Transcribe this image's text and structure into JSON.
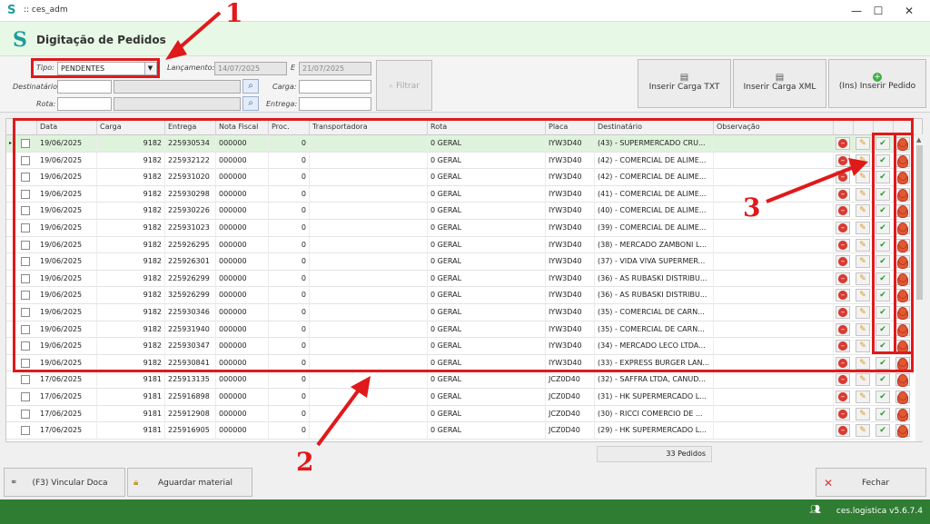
{
  "window": {
    "title": ":: ces_adm",
    "minimize": "—",
    "maximize": "☐",
    "close": "✕"
  },
  "header": {
    "title": "Digitação de Pedidos"
  },
  "filter": {
    "tipo_label": "Tipo:",
    "tipo_value": "PENDENTES",
    "lancamento_label": "Lançamento:",
    "lancamento_from": "14/07/2025",
    "e_label": "E",
    "lancamento_to": "21/07/2025",
    "destinatario_label": "Destinatário:",
    "rota_label": "Rota:",
    "carga_label": "Carga:",
    "entrega_label": "Entrega:",
    "filtrar_label": "Filtrar"
  },
  "actions": {
    "inserir_txt": "Inserir Carga TXT",
    "inserir_xml": "Inserir Carga XML",
    "inserir_pedido": "(Ins) Inserir Pedido"
  },
  "grid": {
    "columns": [
      "Data",
      "Carga",
      "Entrega",
      "Nota Fiscal",
      "Proc.",
      "Transportadora",
      "Rota",
      "Placa",
      "Destinatário",
      "Observação"
    ],
    "rows": [
      {
        "data": "19/06/2025",
        "carga": "9182",
        "entrega": "225930534",
        "nf": "000000",
        "proc": "0",
        "transp": "",
        "rota": "0 GERAL",
        "placa": "IYW3D40",
        "dest": "(43) - SUPERMERCADO CRU...",
        "obs": ""
      },
      {
        "data": "19/06/2025",
        "carga": "9182",
        "entrega": "225932122",
        "nf": "000000",
        "proc": "0",
        "transp": "",
        "rota": "0 GERAL",
        "placa": "IYW3D40",
        "dest": "(42) - COMERCIAL DE ALIME...",
        "obs": ""
      },
      {
        "data": "19/06/2025",
        "carga": "9182",
        "entrega": "225931020",
        "nf": "000000",
        "proc": "0",
        "transp": "",
        "rota": "0 GERAL",
        "placa": "IYW3D40",
        "dest": "(42) - COMERCIAL DE ALIME...",
        "obs": ""
      },
      {
        "data": "19/06/2025",
        "carga": "9182",
        "entrega": "225930298",
        "nf": "000000",
        "proc": "0",
        "transp": "",
        "rota": "0 GERAL",
        "placa": "IYW3D40",
        "dest": "(41) - COMERCIAL DE ALIME...",
        "obs": ""
      },
      {
        "data": "19/06/2025",
        "carga": "9182",
        "entrega": "225930226",
        "nf": "000000",
        "proc": "0",
        "transp": "",
        "rota": "0 GERAL",
        "placa": "IYW3D40",
        "dest": "(40) - COMERCIAL DE ALIME...",
        "obs": ""
      },
      {
        "data": "19/06/2025",
        "carga": "9182",
        "entrega": "225931023",
        "nf": "000000",
        "proc": "0",
        "transp": "",
        "rota": "0 GERAL",
        "placa": "IYW3D40",
        "dest": "(39) - COMERCIAL DE ALIME...",
        "obs": ""
      },
      {
        "data": "19/06/2025",
        "carga": "9182",
        "entrega": "225926295",
        "nf": "000000",
        "proc": "0",
        "transp": "",
        "rota": "0 GERAL",
        "placa": "IYW3D40",
        "dest": "(38) - MERCADO ZAMBONI L...",
        "obs": ""
      },
      {
        "data": "19/06/2025",
        "carga": "9182",
        "entrega": "225926301",
        "nf": "000000",
        "proc": "0",
        "transp": "",
        "rota": "0 GERAL",
        "placa": "IYW3D40",
        "dest": "(37) - VIDA VIVA SUPERMER...",
        "obs": ""
      },
      {
        "data": "19/06/2025",
        "carga": "9182",
        "entrega": "225926299",
        "nf": "000000",
        "proc": "0",
        "transp": "",
        "rota": "0 GERAL",
        "placa": "IYW3D40",
        "dest": "(36) - AS RUBASKI DISTRIBU...",
        "obs": ""
      },
      {
        "data": "19/06/2025",
        "carga": "9182",
        "entrega": "325926299",
        "nf": "000000",
        "proc": "0",
        "transp": "",
        "rota": "0 GERAL",
        "placa": "IYW3D40",
        "dest": "(36) - AS RUBASKI DISTRIBU...",
        "obs": ""
      },
      {
        "data": "19/06/2025",
        "carga": "9182",
        "entrega": "225930346",
        "nf": "000000",
        "proc": "0",
        "transp": "",
        "rota": "0 GERAL",
        "placa": "IYW3D40",
        "dest": "(35) - COMERCIAL DE CARN...",
        "obs": ""
      },
      {
        "data": "19/06/2025",
        "carga": "9182",
        "entrega": "225931940",
        "nf": "000000",
        "proc": "0",
        "transp": "",
        "rota": "0 GERAL",
        "placa": "IYW3D40",
        "dest": "(35) - COMERCIAL DE CARN...",
        "obs": ""
      },
      {
        "data": "19/06/2025",
        "carga": "9182",
        "entrega": "225930347",
        "nf": "000000",
        "proc": "0",
        "transp": "",
        "rota": "0 GERAL",
        "placa": "IYW3D40",
        "dest": "(34) - MERCADO LECO LTDA...",
        "obs": ""
      },
      {
        "data": "19/06/2025",
        "carga": "9182",
        "entrega": "225930841",
        "nf": "000000",
        "proc": "0",
        "transp": "",
        "rota": "0 GERAL",
        "placa": "IYW3D40",
        "dest": "(33) - EXPRESS BURGER LAN...",
        "obs": ""
      },
      {
        "data": "17/06/2025",
        "carga": "9181",
        "entrega": "225913135",
        "nf": "000000",
        "proc": "0",
        "transp": "",
        "rota": "0 GERAL",
        "placa": "JCZ0D40",
        "dest": "(32) - SAFFRA LTDA, CANUD...",
        "obs": ""
      },
      {
        "data": "17/06/2025",
        "carga": "9181",
        "entrega": "225916898",
        "nf": "000000",
        "proc": "0",
        "transp": "",
        "rota": "0 GERAL",
        "placa": "JCZ0D40",
        "dest": "(31) - HK SUPERMERCADO L...",
        "obs": ""
      },
      {
        "data": "17/06/2025",
        "carga": "9181",
        "entrega": "225912908",
        "nf": "000000",
        "proc": "0",
        "transp": "",
        "rota": "0 GERAL",
        "placa": "JCZ0D40",
        "dest": "(30) - RICCI COMERCIO DE ...",
        "obs": ""
      },
      {
        "data": "17/06/2025",
        "carga": "9181",
        "entrega": "225916905",
        "nf": "000000",
        "proc": "0",
        "transp": "",
        "rota": "0 GERAL",
        "placa": "JCZ0D40",
        "dest": "(29) - HK SUPERMERCADO L...",
        "obs": ""
      }
    ],
    "count_label": "33 Pedidos"
  },
  "footer": {
    "vincular": "(F3) Vincular Doca",
    "aguardar": "Aguardar material",
    "fechar": "Fechar"
  },
  "status": {
    "version": "ces.logistica v5.6.7.4"
  },
  "annotations": {
    "n1": "1",
    "n2": "2",
    "n3": "3"
  }
}
